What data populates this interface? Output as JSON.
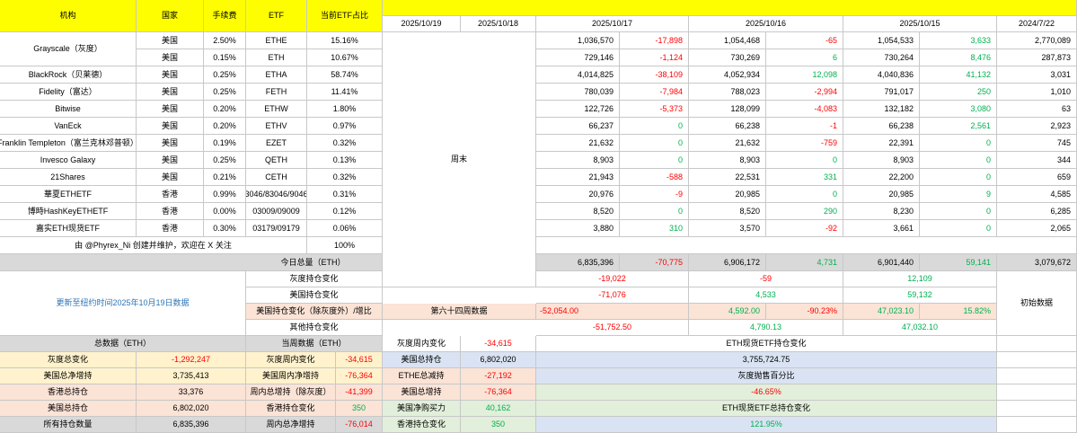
{
  "header": {
    "col_institution": "机构",
    "col_country": "国家",
    "col_fee": "手续费",
    "col_etf": "ETF",
    "col_share": "当前ETF占比",
    "date_1019": "2025/10/19",
    "date_1018": "2025/10/18",
    "date_1017": "2025/10/17",
    "date_1016": "2025/10/16",
    "date_1015": "2025/10/15",
    "date_0722": "2024/7/22"
  },
  "weekend_label": "周末",
  "rows": [
    {
      "name": "Grayscale（灰度）",
      "country": "美国",
      "fee": "2.50%",
      "etf": "ETHE",
      "share": "15.16%",
      "h1017": "1,036,570",
      "d1017": "-17,898",
      "h1016": "1,054,468",
      "d1016": "-65",
      "h1015": "1,054,533",
      "d1015": "3,633",
      "h0722": "2,770,089"
    },
    {
      "name": "",
      "country": "美国",
      "fee": "0.15%",
      "etf": "ETH",
      "share": "10.67%",
      "h1017": "729,146",
      "d1017": "-1,124",
      "h1016": "730,269",
      "d1016": "6",
      "h1015": "730,264",
      "d1015": "8,476",
      "h0722": "287,873"
    },
    {
      "name": "BlackRock（贝莱德）",
      "country": "美国",
      "fee": "0.25%",
      "etf": "ETHA",
      "share": "58.74%",
      "h1017": "4,014,825",
      "d1017": "-38,109",
      "h1016": "4,052,934",
      "d1016": "12,098",
      "h1015": "4,040,836",
      "d1015": "41,132",
      "h0722": "3,031"
    },
    {
      "name": "Fidelity（富达）",
      "country": "美国",
      "fee": "0.25%",
      "etf": "FETH",
      "share": "11.41%",
      "h1017": "780,039",
      "d1017": "-7,984",
      "h1016": "788,023",
      "d1016": "-2,994",
      "h1015": "791,017",
      "d1015": "250",
      "h0722": "1,010"
    },
    {
      "name": "Bitwise",
      "country": "美国",
      "fee": "0.20%",
      "etf": "ETHW",
      "share": "1.80%",
      "h1017": "122,726",
      "d1017": "-5,373",
      "h1016": "128,099",
      "d1016": "-4,083",
      "h1015": "132,182",
      "d1015": "3,080",
      "h0722": "63"
    },
    {
      "name": "VanEck",
      "country": "美国",
      "fee": "0.20%",
      "etf": "ETHV",
      "share": "0.97%",
      "h1017": "66,237",
      "d1017": "0",
      "h1016": "66,238",
      "d1016": "-1",
      "h1015": "66,238",
      "d1015": "2,561",
      "h0722": "2,923"
    },
    {
      "name": "Franklin Templeton（富兰克林邓普顿）",
      "country": "美国",
      "fee": "0.19%",
      "etf": "EZET",
      "share": "0.32%",
      "h1017": "21,632",
      "d1017": "0",
      "h1016": "21,632",
      "d1016": "-759",
      "h1015": "22,391",
      "d1015": "0",
      "h0722": "745"
    },
    {
      "name": "Invesco Galaxy",
      "country": "美国",
      "fee": "0.25%",
      "etf": "QETH",
      "share": "0.13%",
      "h1017": "8,903",
      "d1017": "0",
      "h1016": "8,903",
      "d1016": "0",
      "h1015": "8,903",
      "d1015": "0",
      "h0722": "344"
    },
    {
      "name": "21Shares",
      "country": "美国",
      "fee": "0.21%",
      "etf": "CETH",
      "share": "0.32%",
      "h1017": "21,943",
      "d1017": "-588",
      "h1016": "22,531",
      "d1016": "331",
      "h1015": "22,200",
      "d1015": "0",
      "h0722": "659"
    },
    {
      "name": "華夏ETHETF",
      "country": "香港",
      "fee": "0.99%",
      "etf": "3046/83046/9046",
      "share": "0.31%",
      "h1017": "20,976",
      "d1017": "-9",
      "h1016": "20,985",
      "d1016": "0",
      "h1015": "20,985",
      "d1015": "9",
      "h0722": "4,585"
    },
    {
      "name": "博時HashKeyETHETF",
      "country": "香港",
      "fee": "0.00%",
      "etf": "03009/09009",
      "share": "0.12%",
      "h1017": "8,520",
      "d1017": "0",
      "h1016": "8,520",
      "d1016": "290",
      "h1015": "8,230",
      "d1015": "0",
      "h0722": "6,285"
    },
    {
      "name": "嘉实ETH现货ETF",
      "country": "香港",
      "fee": "0.30%",
      "etf": "03179/09179",
      "share": "0.06%",
      "h1017": "3,880",
      "d1017": "310",
      "h1016": "3,570",
      "d1016": "-92",
      "h1015": "3,661",
      "d1015": "0",
      "h0722": "2,065"
    }
  ],
  "credit": "由 @Phyrex_Ni 创建并维护，欢迎在 X 关注",
  "credit_share": "100%",
  "daily_total": {
    "label": "今日总量（ETH）",
    "h1017": "6,835,396",
    "d1017": "-70,775",
    "h1016": "6,906,172",
    "d1016": "4,731",
    "h1015": "6,901,440",
    "d1015": "59,141",
    "h0722": "3,079,672"
  },
  "update_note": "更新至纽约时间2025年10月19日数据",
  "initial_data": "初始数据",
  "changes": {
    "grayscale": {
      "label": "灰度持仓变化",
      "v1017": "-19,022",
      "v1016": "-59",
      "v1015": "12,109"
    },
    "us": {
      "label": "美国持仓变化",
      "v1017": "-71,076",
      "v1016": "4,533",
      "v1015": "59,132"
    },
    "us_ex_gray": {
      "label": "美国持仓变化（除灰度外）/增比",
      "week": "第六十四周数据",
      "v1017": "-52,054.00",
      "v1016": "4,592.00",
      "p1016": "-90.23%",
      "v1015": "47,023.10",
      "p1015": "15.82%"
    },
    "other": {
      "label": "其他持仓变化",
      "v1017": "-51,752.50",
      "v1016": "4,790.13",
      "v1015": "47,032.10"
    }
  },
  "summary": {
    "total_label": "总数据（ETH）",
    "current_label": "当周数据（ETH）",
    "gray_week_label": "灰度周内变化",
    "gray_week_value": "-34,615",
    "etf_change_title": "ETH现货ETF持仓变化",
    "left": [
      {
        "label": "灰度总变化",
        "value": "-1,292,247"
      },
      {
        "label": "美国总净增持",
        "value": "3,735,413"
      },
      {
        "label": "香港总持仓",
        "value": "33,376"
      },
      {
        "label": "美国总持仓",
        "value": "6,802,020"
      },
      {
        "label": "所有持仓数量",
        "value": "6,835,396"
      }
    ],
    "mid": [
      {
        "label": "灰度周内变化",
        "value": "-34,615"
      },
      {
        "label": "美国周内净增持",
        "value": "-76,364"
      },
      {
        "label": "周内总增持（除灰度）",
        "value": "-41,399"
      },
      {
        "label": "香港持仓变化",
        "value": "350"
      },
      {
        "label": "周内总净增持",
        "value": "-76,014"
      }
    ],
    "right": [
      {
        "label": "美国总持仓",
        "value": "6,802,020"
      },
      {
        "label": "ETHE总减持",
        "value": "-27,192"
      },
      {
        "label": "美国总增持",
        "value": "-76,364"
      },
      {
        "label": "美国净购买力",
        "value": "40,162"
      },
      {
        "label": "香港持仓变化",
        "value": "350"
      }
    ],
    "far": [
      {
        "value": "3,755,724.75"
      },
      {
        "value": "灰度抛售百分比"
      },
      {
        "value": "-46.65%"
      },
      {
        "value": "ETH现货ETF总持仓变化"
      },
      {
        "value": "121.95%"
      }
    ]
  },
  "colors": {
    "header_yellow": "#fefe00",
    "red": "#ff0000",
    "green": "#00b050",
    "link_blue": "#2e75b6"
  }
}
